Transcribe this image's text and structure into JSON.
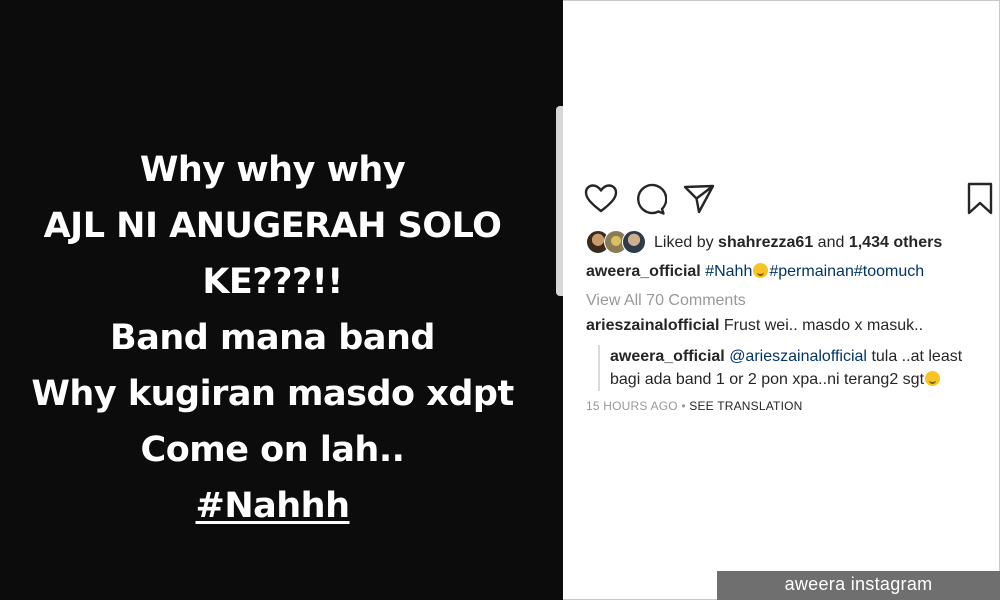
{
  "story": {
    "lines": [
      "Why why why",
      "AJL NI ANUGERAH SOLO",
      "KE???!!",
      "Band mana band",
      "Why kugiran masdo xdpt",
      "Come on lah..",
      "#Nahhh"
    ],
    "background_color": "#0c0c0c"
  },
  "post": {
    "actions": {
      "icons": [
        "heart-icon",
        "comment-icon",
        "share-icon",
        "bookmark-icon"
      ]
    },
    "likes": {
      "prefix": "Liked by",
      "user": "shahrezza61",
      "joiner": "and",
      "count": "1,434 others"
    },
    "caption": {
      "username": "aweera_official",
      "tag1": "#Nahh",
      "tag2": "#permainan",
      "tag3": "#toomuch"
    },
    "view_all_comments": "View All 70 Comments",
    "comments": [
      {
        "username": "arieszainalofficial",
        "text": "Frust wei.. masdo x masuk.."
      }
    ],
    "reply": {
      "username": "aweera_official",
      "mention": "@arieszainalofficial",
      "text_line1": "tula ..at least",
      "text_line2": "bagi ada band 1 or 2 pon xpa..ni terang2 sgt"
    },
    "timestamp": "15 HOURS AGO",
    "separator": "•",
    "see_translation": "SEE TRANSLATION",
    "link_color": "#003569"
  },
  "credit": "aweera instagram"
}
